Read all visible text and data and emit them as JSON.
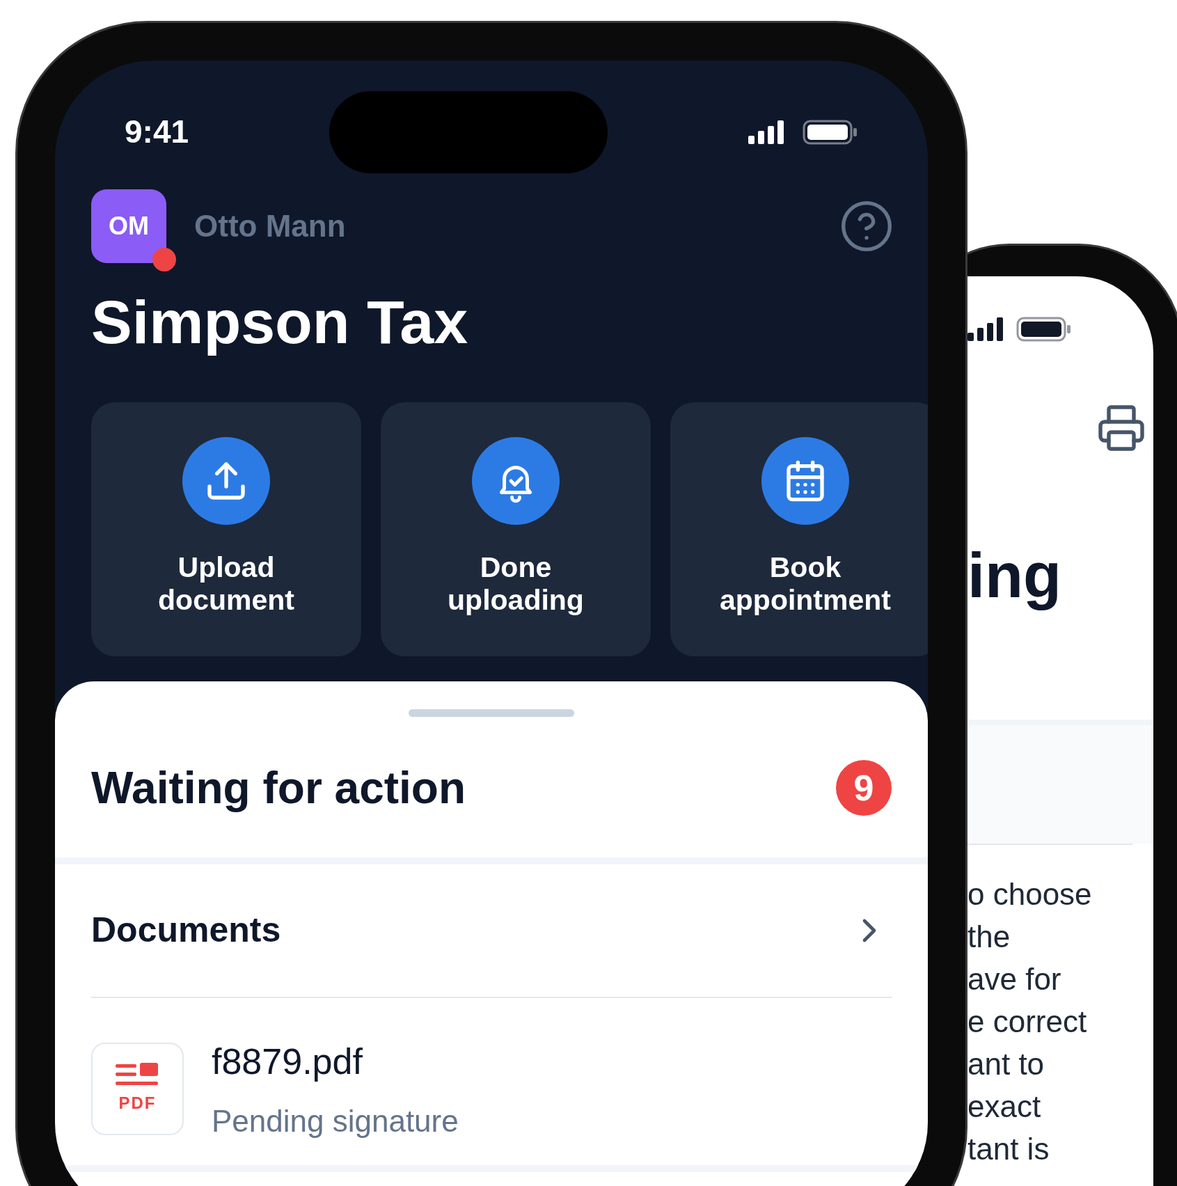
{
  "front_phone": {
    "status_bar": {
      "time": "9:41"
    },
    "user": {
      "initials": "OM",
      "name": "Otto Mann",
      "notification": true
    },
    "title": "Simpson Tax",
    "actions": [
      {
        "label": "Upload document",
        "kind": "upload"
      },
      {
        "label": "Done uploading",
        "kind": "bell"
      },
      {
        "label": "Book appointment",
        "kind": "calendar"
      }
    ],
    "sheet": {
      "heading": "Waiting for action",
      "count": "9",
      "section": "Documents",
      "documents": [
        {
          "name": "f8879.pdf",
          "status": "Pending signature",
          "type": "PDF"
        }
      ]
    }
  },
  "back_phone": {
    "heading": "ing",
    "text_lines": [
      "o choose",
      "the",
      "ave for",
      "e correct",
      "ant to",
      "exact",
      "tant is"
    ]
  }
}
